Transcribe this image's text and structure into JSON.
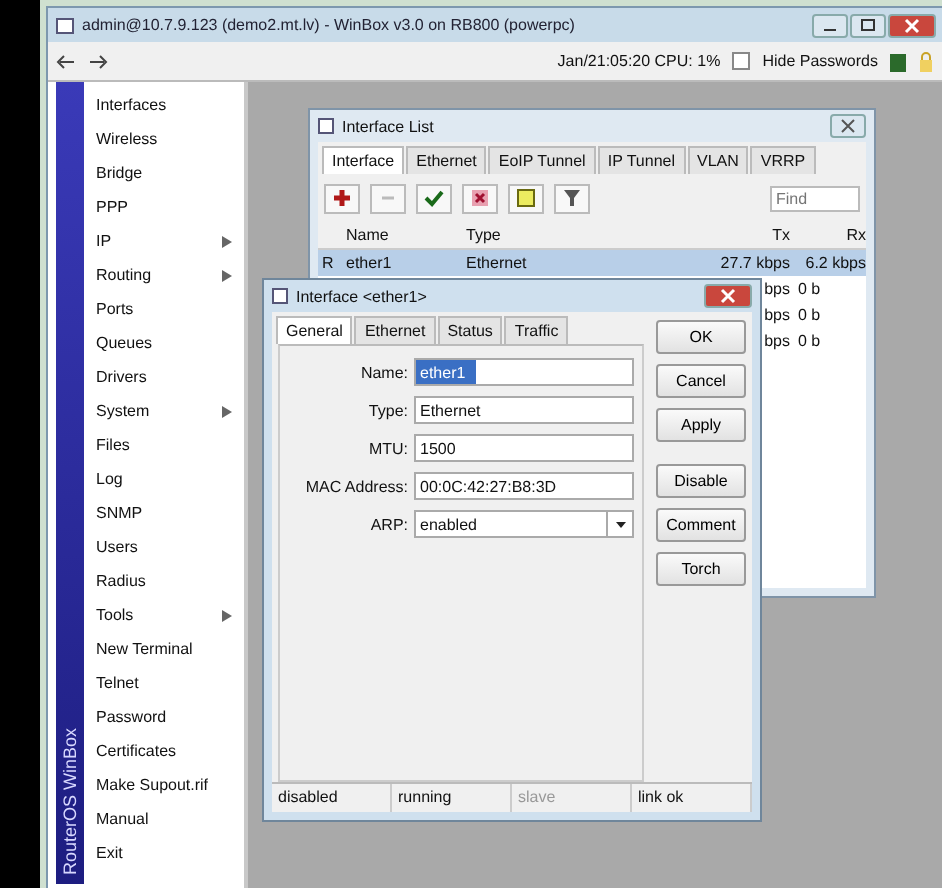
{
  "window": {
    "title": "admin@10.7.9.123 (demo2.mt.lv) - WinBox v3.0 on RB800 (powerpc)"
  },
  "toolbar": {
    "status": "Jan/21:05:20 CPU: 1%",
    "hide_passwords": {
      "label": "Hide Passwords",
      "checked": false
    }
  },
  "sidebar": {
    "brand": "RouterOS WinBox",
    "items": [
      {
        "label": "Interfaces",
        "submenu": false
      },
      {
        "label": "Wireless",
        "submenu": false
      },
      {
        "label": "Bridge",
        "submenu": false
      },
      {
        "label": "PPP",
        "submenu": false
      },
      {
        "label": "IP",
        "submenu": true
      },
      {
        "label": "Routing",
        "submenu": true
      },
      {
        "label": "Ports",
        "submenu": false
      },
      {
        "label": "Queues",
        "submenu": false
      },
      {
        "label": "Drivers",
        "submenu": false
      },
      {
        "label": "System",
        "submenu": true
      },
      {
        "label": "Files",
        "submenu": false
      },
      {
        "label": "Log",
        "submenu": false
      },
      {
        "label": "SNMP",
        "submenu": false
      },
      {
        "label": "Users",
        "submenu": false
      },
      {
        "label": "Radius",
        "submenu": false
      },
      {
        "label": "Tools",
        "submenu": true
      },
      {
        "label": "New Terminal",
        "submenu": false
      },
      {
        "label": "Telnet",
        "submenu": false
      },
      {
        "label": "Password",
        "submenu": false
      },
      {
        "label": "Certificates",
        "submenu": false
      },
      {
        "label": "Make Supout.rif",
        "submenu": false
      },
      {
        "label": "Manual",
        "submenu": false
      },
      {
        "label": "Exit",
        "submenu": false
      }
    ]
  },
  "interface_list": {
    "title": "Interface List",
    "tabs": [
      {
        "label": "Interface",
        "selected": true
      },
      {
        "label": "Ethernet",
        "selected": false
      },
      {
        "label": "EoIP Tunnel",
        "selected": false
      },
      {
        "label": "IP Tunnel",
        "selected": false
      },
      {
        "label": "VLAN",
        "selected": false
      },
      {
        "label": "VRRP",
        "selected": false
      }
    ],
    "find": {
      "placeholder": "Find"
    },
    "columns": [
      "Name",
      "Type",
      "Tx",
      "Rx"
    ],
    "rows": [
      {
        "flag": "R",
        "name": "ether1",
        "type": "Ethernet",
        "tx": "27.7 kbps",
        "rx": "6.2 kbps",
        "selected": true
      },
      {
        "flag": "",
        "name": "",
        "type": "",
        "tx": "bps",
        "rx": "0 b",
        "selected": false
      },
      {
        "flag": "",
        "name": "",
        "type": "",
        "tx": "bps",
        "rx": "0 b",
        "selected": false
      },
      {
        "flag": "",
        "name": "",
        "type": "",
        "tx": "bps",
        "rx": "0 b",
        "selected": false
      }
    ]
  },
  "dialog": {
    "title": "Interface <ether1>",
    "tabs": [
      {
        "label": "General",
        "selected": true
      },
      {
        "label": "Ethernet",
        "selected": false
      },
      {
        "label": "Status",
        "selected": false
      },
      {
        "label": "Traffic",
        "selected": false
      }
    ],
    "fields": [
      {
        "label": "Name:",
        "value": "ether1",
        "kind": "text"
      },
      {
        "label": "Type:",
        "value": "Ethernet",
        "kind": "text"
      },
      {
        "label": "MTU:",
        "value": "1500",
        "kind": "text"
      },
      {
        "label": "MAC Address:",
        "value": "00:0C:42:27:B8:3D",
        "kind": "text"
      },
      {
        "label": "ARP:",
        "value": "enabled",
        "kind": "dropdown"
      }
    ],
    "buttons": [
      "OK",
      "Cancel",
      "Apply",
      "Disable",
      "Comment",
      "Torch"
    ],
    "status": [
      {
        "text": "disabled",
        "dimmed": false
      },
      {
        "text": "running",
        "dimmed": false
      },
      {
        "text": "slave",
        "dimmed": true
      },
      {
        "text": "link ok",
        "dimmed": false
      }
    ]
  }
}
